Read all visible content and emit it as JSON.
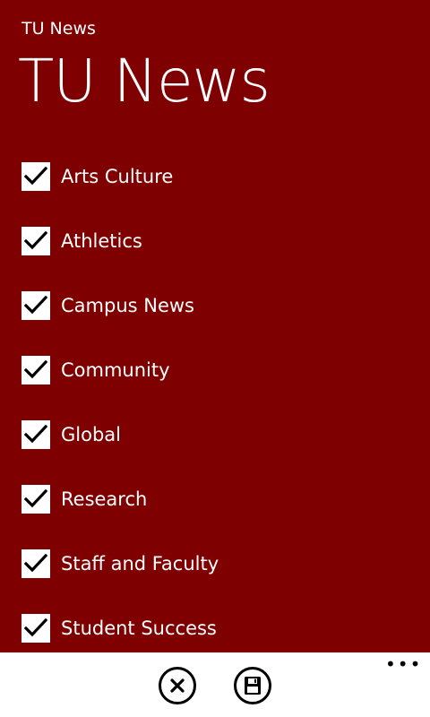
{
  "app": {
    "header_small": "TU News",
    "header_large": "TU News"
  },
  "categories": [
    {
      "label": "Arts Culture",
      "checked": true
    },
    {
      "label": "Athletics",
      "checked": true
    },
    {
      "label": "Campus News",
      "checked": true
    },
    {
      "label": "Community",
      "checked": true
    },
    {
      "label": "Global",
      "checked": true
    },
    {
      "label": "Research",
      "checked": true
    },
    {
      "label": "Staff and Faculty",
      "checked": true
    },
    {
      "label": "Student Success",
      "checked": true
    }
  ],
  "appbar": {
    "ellipsis": "•••",
    "buttons": [
      {
        "icon": "close-icon"
      },
      {
        "icon": "save-icon"
      }
    ]
  },
  "colors": {
    "background": "#7f0000",
    "appbar": "#ffffff",
    "text": "#ffffff",
    "checkbox": "#ffffff",
    "checkmark": "#000000"
  }
}
